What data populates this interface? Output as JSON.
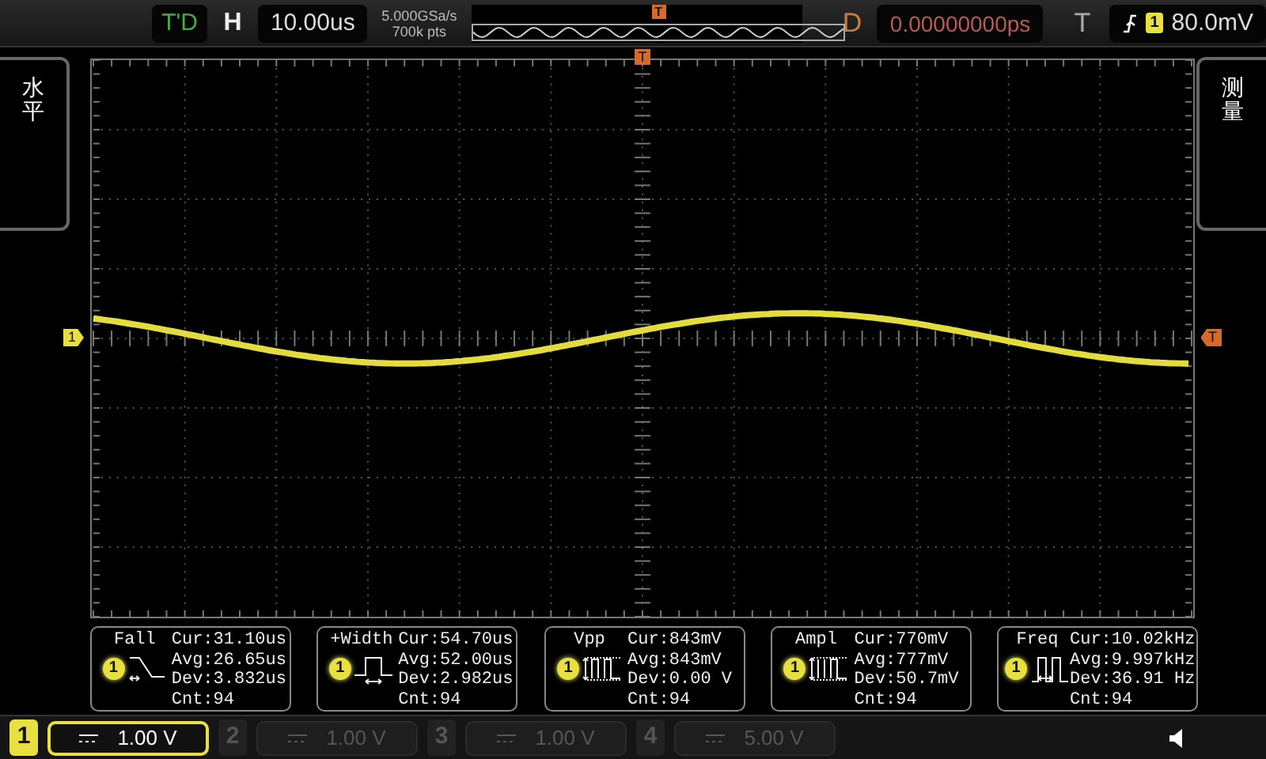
{
  "top_bar": {
    "status": "T'D",
    "horizontal_label": "H",
    "timebase": "10.00us",
    "sample_rate": "5.000GSa/s",
    "memory_depth": "700k pts",
    "overview_trigger": "T",
    "delay_label": "D",
    "delay": "0.00000000ps",
    "trigger_label": "T",
    "trigger_source": "1",
    "trigger_level": "80.0mV"
  },
  "side_menus": {
    "left": "水平",
    "right": "测量"
  },
  "graticule": {
    "trigger_top_marker": "T",
    "trigger_level_marker": "T",
    "channel_marker": "1"
  },
  "measurements": [
    {
      "kind": "fall",
      "name": "Fall",
      "channel": "1",
      "cur": "Cur:31.10us",
      "avg": "Avg:26.65us",
      "dev": "Dev:3.832us",
      "cnt": "Cnt:94"
    },
    {
      "kind": "pwidth",
      "name": "+Width",
      "channel": "1",
      "cur": "Cur:54.70us",
      "avg": "Avg:52.00us",
      "dev": "Dev:2.982us",
      "cnt": "Cnt:94"
    },
    {
      "kind": "vpp",
      "name": "Vpp",
      "channel": "1",
      "cur": "Cur:843mV",
      "avg": "Avg:843mV",
      "dev": "Dev:0.00 V",
      "cnt": "Cnt:94"
    },
    {
      "kind": "ampl",
      "name": "Ampl",
      "channel": "1",
      "cur": "Cur:770mV",
      "avg": "Avg:777mV",
      "dev": "Dev:50.7mV",
      "cnt": "Cnt:94"
    },
    {
      "kind": "freq",
      "name": "Freq",
      "channel": "1",
      "cur": "Cur:10.02kHz",
      "avg": "Avg:9.997kHz",
      "dev": "Dev:36.91 Hz",
      "cnt": "Cnt:94"
    }
  ],
  "channels": [
    {
      "number": "1",
      "scale": "1.00 V",
      "selected": true
    },
    {
      "number": "2",
      "scale": "1.00 V",
      "selected": false
    },
    {
      "number": "3",
      "scale": "1.00 V",
      "selected": false
    },
    {
      "number": "4",
      "scale": "5.00 V",
      "selected": false
    }
  ]
}
